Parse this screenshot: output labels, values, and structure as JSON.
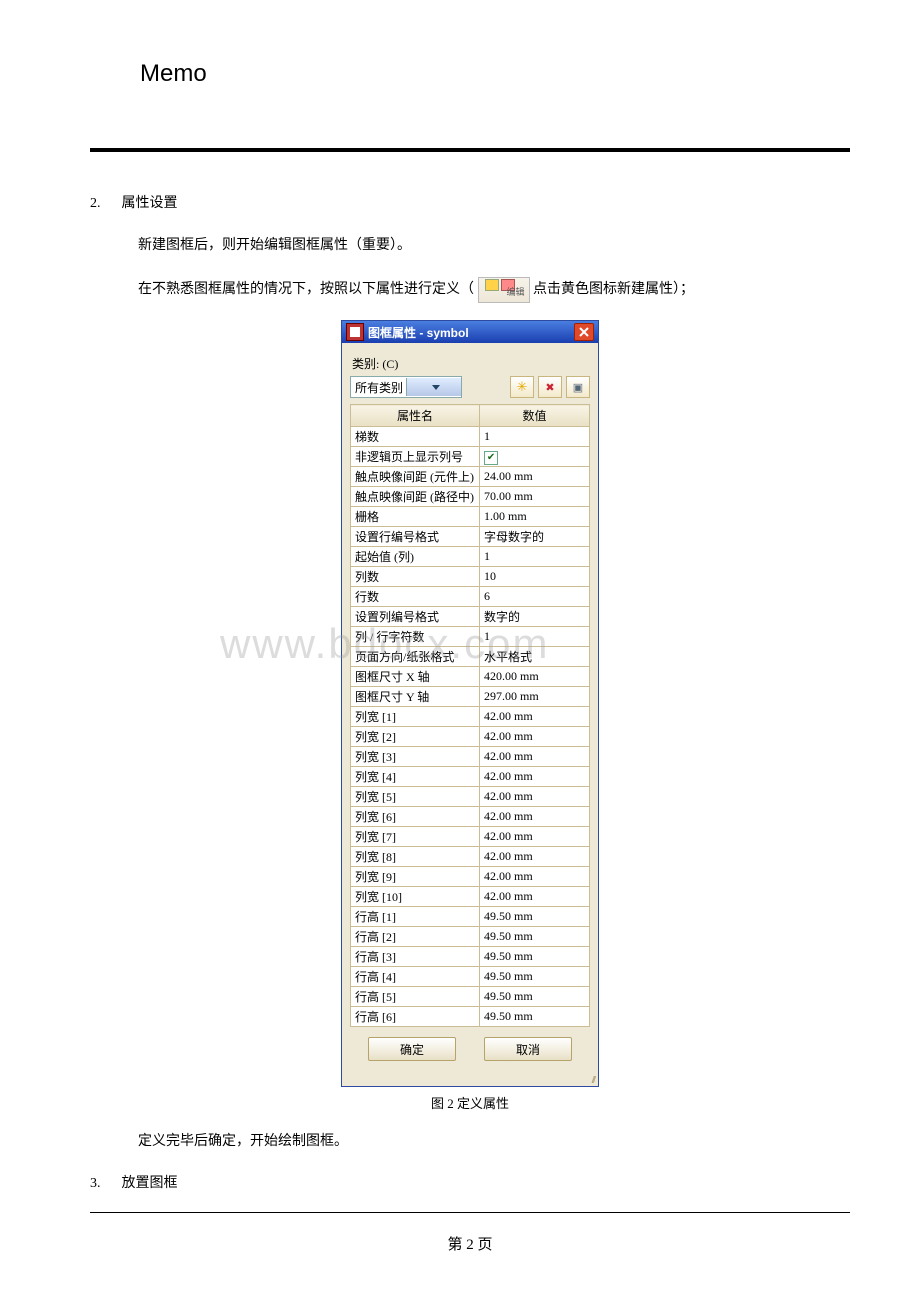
{
  "header": {
    "title": "Memo"
  },
  "section2": {
    "num": "2.",
    "title": "属性设置",
    "p1": "新建图框后，则开始编辑图框属性（重要）。",
    "p2a": "在不熟悉图框属性的情况下，按照以下属性进行定义（",
    "p2b": "点击黄色图标新建属性）；",
    "inline_icon_label": "编辑"
  },
  "dialog": {
    "title": "图框属性 - symbol",
    "category_label": "类别: (C)",
    "category_value": "所有类别",
    "col_name": "属性名",
    "col_value": "数值",
    "rows": [
      {
        "name": "梯数",
        "value": "1"
      },
      {
        "name": "非逻辑页上显示列号",
        "value": "__CHECK__"
      },
      {
        "name": "触点映像间距 (元件上)",
        "value": "24.00 mm"
      },
      {
        "name": "触点映像间距 (路径中)",
        "value": "70.00 mm"
      },
      {
        "name": "栅格",
        "value": "1.00 mm"
      },
      {
        "name": "设置行编号格式",
        "value": "字母数字的"
      },
      {
        "name": "起始值 (列)",
        "value": "1"
      },
      {
        "name": "列数",
        "value": "10"
      },
      {
        "name": "行数",
        "value": "6"
      },
      {
        "name": "设置列编号格式",
        "value": "数字的"
      },
      {
        "name": "列 / 行字符数",
        "value": "1"
      },
      {
        "name": "页面方向/纸张格式",
        "value": "水平格式"
      },
      {
        "name": "图框尺寸 X 轴",
        "value": "420.00 mm"
      },
      {
        "name": "图框尺寸 Y 轴",
        "value": "297.00 mm"
      },
      {
        "name": "列宽 [1]",
        "value": "42.00 mm"
      },
      {
        "name": "列宽 [2]",
        "value": "42.00 mm"
      },
      {
        "name": "列宽 [3]",
        "value": "42.00 mm"
      },
      {
        "name": "列宽 [4]",
        "value": "42.00 mm"
      },
      {
        "name": "列宽 [5]",
        "value": "42.00 mm"
      },
      {
        "name": "列宽 [6]",
        "value": "42.00 mm"
      },
      {
        "name": "列宽 [7]",
        "value": "42.00 mm"
      },
      {
        "name": "列宽 [8]",
        "value": "42.00 mm"
      },
      {
        "name": "列宽 [9]",
        "value": "42.00 mm"
      },
      {
        "name": "列宽 [10]",
        "value": "42.00 mm"
      },
      {
        "name": "行高 [1]",
        "value": "49.50 mm"
      },
      {
        "name": "行高 [2]",
        "value": "49.50 mm"
      },
      {
        "name": "行高 [3]",
        "value": "49.50 mm"
      },
      {
        "name": "行高 [4]",
        "value": "49.50 mm"
      },
      {
        "name": "行高 [5]",
        "value": "49.50 mm"
      },
      {
        "name": "行高 [6]",
        "value": "49.50 mm"
      }
    ],
    "ok": "确定",
    "cancel": "取消"
  },
  "figcaption": "图 2 定义属性",
  "after_fig": "定义完毕后确定，开始绘制图框。",
  "section3": {
    "num": "3.",
    "title": "放置图框"
  },
  "footer": "第 2 页",
  "watermark": "www.bdocx.com"
}
